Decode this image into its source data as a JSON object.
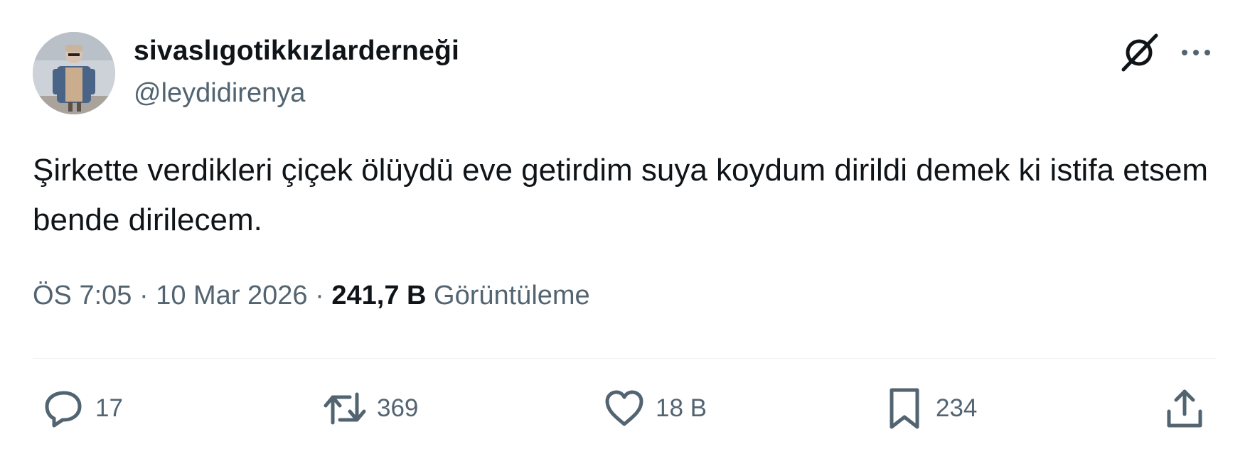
{
  "user": {
    "display_name": "sivaslıgotikkızlarderneği",
    "handle": "@leydidirenya",
    "avatar_icon": "user-avatar"
  },
  "header": {
    "grok_icon": "grok-icon",
    "more_icon": "more-horizontal-icon"
  },
  "tweet": {
    "text": "Şirkette verdikleri çiçek ölüydü eve getirdim suya koydum dirildi demek ki istifa etsem bende dirilecem.",
    "time": "ÖS 7:05",
    "separator": " · ",
    "date": "10 Mar 2026",
    "views_count": "241,7 B",
    "views_label": "Görüntüleme"
  },
  "actions": {
    "reply": {
      "icon": "reply-icon",
      "count": "17"
    },
    "retweet": {
      "icon": "retweet-icon",
      "count": "369"
    },
    "like": {
      "icon": "heart-icon",
      "count": "18 B"
    },
    "bookmark": {
      "icon": "bookmark-icon",
      "count": "234"
    },
    "share": {
      "icon": "share-icon"
    }
  },
  "colors": {
    "text_primary": "#0f1419",
    "text_secondary": "#536471",
    "divider": "#eff3f4",
    "background": "#ffffff"
  }
}
